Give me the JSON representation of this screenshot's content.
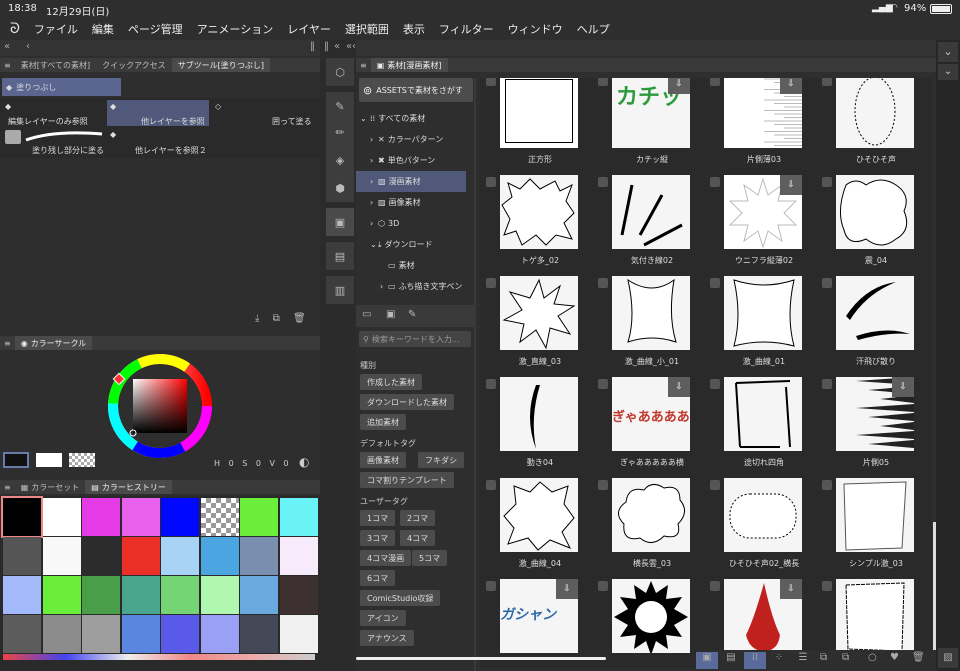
{
  "status": {
    "time": "18:38",
    "date": "12月29日(日)",
    "battery": "94%"
  },
  "menu": [
    "ファイル",
    "編集",
    "ページ管理",
    "アニメーション",
    "レイヤー",
    "選択範囲",
    "表示",
    "フィルター",
    "ウィンドウ",
    "ヘルプ"
  ],
  "left_tabs": [
    "素材[すべての素材]",
    "クイックアクセス",
    "サブツール[塗りつぶし]"
  ],
  "subtool": {
    "group": "塗りつぶし",
    "items": [
      "編集レイヤーのみ参照",
      "他レイヤーを参照",
      "囲って塗る",
      "塗り残し部分に塗る",
      "他レイヤーを参照２"
    ]
  },
  "color_circle": {
    "tab": "カラーサークル",
    "h_label": "H",
    "h": "0",
    "s_label": "S",
    "s": "0",
    "v_label": "V",
    "v": "0"
  },
  "color_tabs": [
    "カラーセット",
    "カラーヒストリー"
  ],
  "history_colors": [
    "#000000",
    "#ffffff",
    "#e43be6",
    "#e860ec",
    "#0008ff",
    "#cccccc",
    "#6aee3a",
    "#6af3f7",
    "#555555",
    "#f8f8f8",
    "#2c2c2c",
    "#ea2f27",
    "#a7d3f7",
    "#4aa5e0",
    "#7a8fb0",
    "#f7eafa",
    "#a2b9fa",
    "#6aee3a",
    "#4a9e4a",
    "#4aa58e",
    "#75d575",
    "#b0f7b0",
    "#6aa8e0",
    "#3c3030",
    "#5c5c5c",
    "#8c8c8c",
    "#9e9e9e",
    "#5a86e0",
    "#5a5ae8",
    "#9aa0f5",
    "#444856",
    "#f0f0f0"
  ],
  "material_panel": {
    "tab": "素材[漫画素材]",
    "assets_btn": "ASSETSで素材をさがす"
  },
  "tree": [
    "すべての素材",
    "カラーパターン",
    "単色パターン",
    "漫画素材",
    "画像素材",
    "3D",
    "ダウンロード",
    "素材",
    "ふち描き文字ペン"
  ],
  "search_placeholder": "検索キーワードを入力...",
  "kind_label": "種別",
  "kind_tags": [
    "作成した素材",
    "ダウンロードした素材",
    "追加素材"
  ],
  "default_label": "デフォルトタグ",
  "default_tags": [
    "画像素材",
    "フキダシ",
    "コマ割りテンプレート"
  ],
  "user_label": "ユーザータグ",
  "user_tags": [
    "1コマ",
    "2コマ",
    "3コマ",
    "4コマ",
    "4コマ漫画",
    "5コマ",
    "6コマ",
    "ComicStudio収録",
    "アイコン",
    "アナウンス"
  ],
  "materials": [
    {
      "label": "正方形",
      "dl": false
    },
    {
      "label": "カチッ縦",
      "dl": true
    },
    {
      "label": "片側薄03",
      "dl": true
    },
    {
      "label": "ひそひそ声",
      "dl": false
    },
    {
      "label": "トゲ多_02",
      "dl": false
    },
    {
      "label": "気付き線02",
      "dl": false
    },
    {
      "label": "ウニフラ縦薄02",
      "dl": true
    },
    {
      "label": "震_04",
      "dl": false
    },
    {
      "label": "激_直線_03",
      "dl": false
    },
    {
      "label": "激_曲線_小_01",
      "dl": false
    },
    {
      "label": "激_曲線_01",
      "dl": false
    },
    {
      "label": "汗飛び散り",
      "dl": false
    },
    {
      "label": "動き04",
      "dl": false
    },
    {
      "label": "ぎゃあああああ横",
      "dl": true
    },
    {
      "label": "途切れ四角",
      "dl": false
    },
    {
      "label": "片側05",
      "dl": true
    },
    {
      "label": "激_曲線_04",
      "dl": false
    },
    {
      "label": "横長雲_03",
      "dl": false
    },
    {
      "label": "ひそひそ声02_横長",
      "dl": false
    },
    {
      "label": "シンプル激_03",
      "dl": false
    },
    {
      "label": "",
      "dl": true
    },
    {
      "label": "",
      "dl": false
    },
    {
      "label": "",
      "dl": true
    },
    {
      "label": "",
      "dl": false
    }
  ],
  "thumb_text": {
    "kachi": "カチッ",
    "gyaa": "ぎゃあああああ",
    "gasha": "ガシャン"
  },
  "colors": {
    "accent": "#5a6a9a",
    "panel": "#2e2e2e",
    "selected": "#50597a"
  }
}
